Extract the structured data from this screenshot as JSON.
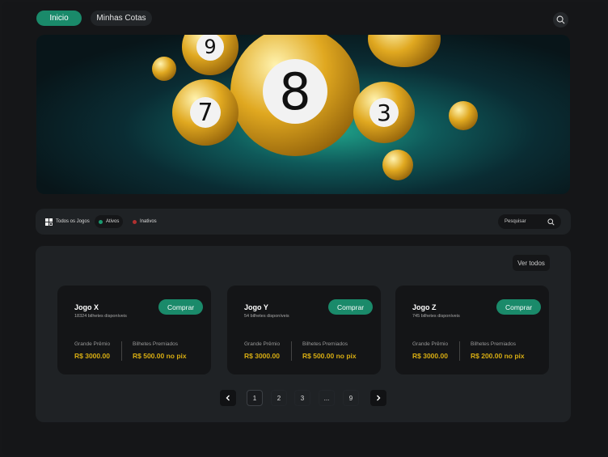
{
  "nav": {
    "tabs": [
      {
        "label": "Inicio",
        "active": true
      },
      {
        "label": "Minhas Cotas",
        "active": false
      }
    ],
    "search_icon": "search-icon"
  },
  "banner": {
    "balls": [
      "9",
      "8",
      "7",
      "3"
    ]
  },
  "filters": {
    "all": "Todos os Jogos",
    "active": "Ativos",
    "inactive": "Inativos",
    "search_placeholder": "Pesquisar",
    "colors": {
      "active": "#1a9a70",
      "inactive": "#b03030"
    }
  },
  "games": {
    "view_all": "Ver todos",
    "cards": [
      {
        "name": "Jogo X",
        "available": "18324 bilhetes disponíveis",
        "buy": "Comprar",
        "prize_label": "Grande Prêmio",
        "prize": "R$ 3000.00",
        "tickets_label": "Bilhetes Premiados",
        "tickets": "R$ 500.00 no pix"
      },
      {
        "name": "Jogo Y",
        "available": "54 bilhetes disponíveis",
        "buy": "Comprar",
        "prize_label": "Grande Prêmio",
        "prize": "R$ 3000.00",
        "tickets_label": "Bilhetes Premiados",
        "tickets": "R$ 500.00 no pix"
      },
      {
        "name": "Jogo Z",
        "available": "745 bilhetes disponíveis",
        "buy": "Comprar",
        "prize_label": "Grande Prêmio",
        "prize": "R$ 3000.00",
        "tickets_label": "Bilhetes Premiados",
        "tickets": "R$ 200.00 no pix"
      }
    ]
  },
  "pagination": {
    "pages": [
      "1",
      "2",
      "3",
      "...",
      "9"
    ],
    "current": "1"
  },
  "colors": {
    "accent": "#1a8a6a",
    "gold": "#d8ad12"
  }
}
